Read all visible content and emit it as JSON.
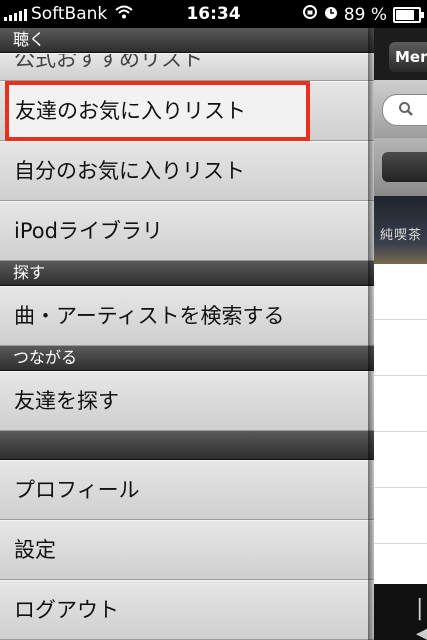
{
  "status_bar": {
    "carrier": "SoftBank",
    "time": "16:34",
    "battery": "89 %",
    "battery_level": 0.89
  },
  "menu": {
    "sections": [
      {
        "title": "聴く",
        "items": [
          "公式おすすめリスト",
          "友達のお気に入りリスト",
          "自分のお気に入りリスト",
          "iPodライブラリ"
        ]
      },
      {
        "title": "探す",
        "items": [
          "曲・アーティストを検索する"
        ]
      },
      {
        "title": "つながる",
        "items": [
          "友達を探す"
        ]
      },
      {
        "title": "",
        "items": [
          "プロフィール",
          "設定",
          "ログアウト"
        ]
      }
    ]
  },
  "background_app": {
    "menu_button": "Men",
    "banner_text": "純喫茶"
  }
}
